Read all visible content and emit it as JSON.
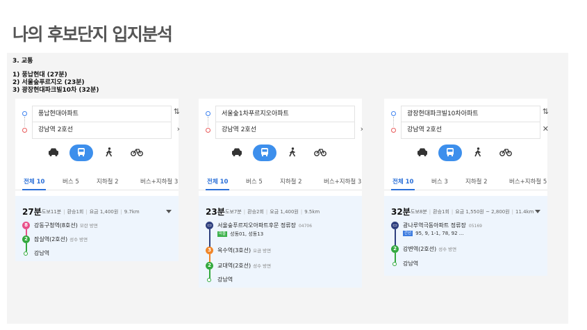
{
  "title": "나의 후보단지 입지분석",
  "section": "3. 교통",
  "routes": [
    "1) 풍납현대 (27분)",
    "2) 서울숲푸르지오 (23분)",
    "3) 광장현대파크빌10차 (32분)"
  ],
  "colors": {
    "accent": "#3d8fec",
    "line8": "#e8508a",
    "line2": "#33a93e",
    "line3": "#f0862a",
    "bus": "#2e3f7e"
  },
  "cards": [
    {
      "origin": "풍납현대아파트",
      "destination": "강남역 2호선",
      "side_icons": [
        "swap-icon",
        "chevron-right-icon"
      ],
      "tabs": [
        "전체 10",
        "버스 5",
        "지하철 2",
        "버스+지하철 3"
      ],
      "duration": "27분",
      "meta": [
        "도보11분",
        "환승1회",
        "요금 1,400원",
        "9.7km"
      ],
      "steps": [
        {
          "badge": "8",
          "name": "강동구청역(8호선)",
          "dir": "모란 방면"
        },
        {
          "badge": "2",
          "name": "잠실역(2호선)",
          "dir": "성수 방면"
        },
        {
          "badge": "",
          "name": "강남역",
          "dir": ""
        }
      ]
    },
    {
      "origin": "서울숲1차푸르지오아파트",
      "destination": "강남역 2호선",
      "side_icons": [
        "swap-icon",
        "chevron-right-icon"
      ],
      "tabs": [
        "전체 10",
        "버스 5",
        "지하철 2",
        "버스+지하철 3"
      ],
      "duration": "23분",
      "meta": [
        "도보7분",
        "환승2회",
        "요금 1,400원",
        "9.5km"
      ],
      "steps": [
        {
          "badge": "bus",
          "name": "서울숲푸르지오아파트후문 정류장",
          "code": "04706",
          "tag": "마을",
          "sub": "성동01, 성동13"
        },
        {
          "badge": "3",
          "name": "옥수역(3호선)",
          "dir": "오금 방면"
        },
        {
          "badge": "2",
          "name": "교대역(2호선)",
          "dir": "성수 방면"
        },
        {
          "badge": "",
          "name": "강남역",
          "dir": ""
        }
      ]
    },
    {
      "origin": "광장현대파크빌10차아파트",
      "destination": "강남역 2호선",
      "side_icons": [
        "swap-icon",
        "close-icon"
      ],
      "tabs": [
        "전체 10",
        "버스 3",
        "지하철 2",
        "버스+지하철 5"
      ],
      "duration": "32분",
      "meta": [
        "도보8분",
        "환승1회",
        "요금 1,550원 ~ 2,800원",
        "11.4km"
      ],
      "steps": [
        {
          "badge": "bus",
          "name": "광나루역극동아파트 정류장",
          "code": "05169",
          "tag": "간선",
          "sub": "95, 9, 1-1, 78, 92 ..."
        },
        {
          "badge": "2",
          "name": "강변역(2호선)",
          "dir": "성수 방면"
        },
        {
          "badge": "",
          "name": "강남역",
          "dir": ""
        }
      ]
    }
  ]
}
